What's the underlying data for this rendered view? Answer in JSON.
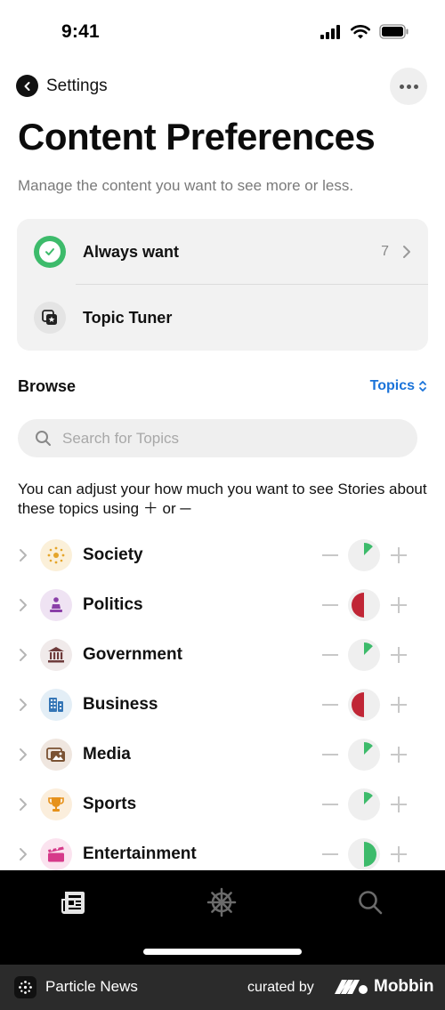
{
  "status_bar": {
    "time": "9:41"
  },
  "nav": {
    "back_label": "Settings"
  },
  "page": {
    "title": "Content Preferences",
    "subtitle": "Manage the content you want to see more or less."
  },
  "card": {
    "always_want": {
      "label": "Always want",
      "count": "7",
      "icon": "checkmark-icon"
    },
    "topic_tuner": {
      "label": "Topic Tuner",
      "icon": "topic-tuner-icon"
    }
  },
  "browse": {
    "label": "Browse",
    "sort_label": "Topics",
    "search_placeholder": "Search for Topics",
    "info_text": "You can adjust your how much you want to see Stories about these topics using ＋ or ─"
  },
  "topics": [
    {
      "label": "Society",
      "icon": "sparkles-icon",
      "icon_bg": "#fbf0d9",
      "icon_color": "#e5a52a",
      "level": 0.125,
      "level_color": "#3dbb6b"
    },
    {
      "label": "Politics",
      "icon": "podium-icon",
      "icon_bg": "#efe3f3",
      "icon_color": "#8a3fa8",
      "level": 0.5,
      "level_color": "#c02636",
      "level_side": "left"
    },
    {
      "label": "Government",
      "icon": "building-columns-icon",
      "icon_bg": "#f0eaea",
      "icon_color": "#6e3b3b",
      "level": 0.125,
      "level_color": "#3dbb6b"
    },
    {
      "label": "Business",
      "icon": "office-building-icon",
      "icon_bg": "#e3eef6",
      "icon_color": "#3576b6",
      "level": 0.5,
      "level_color": "#c02636",
      "level_side": "left"
    },
    {
      "label": "Media",
      "icon": "photos-icon",
      "icon_bg": "#efe6df",
      "icon_color": "#7a5233",
      "level": 0.125,
      "level_color": "#3dbb6b"
    },
    {
      "label": "Sports",
      "icon": "trophy-icon",
      "icon_bg": "#fbeedc",
      "icon_color": "#e6911a",
      "level": 0.125,
      "level_color": "#3dbb6b"
    },
    {
      "label": "Entertainment",
      "icon": "clapperboard-icon",
      "icon_bg": "#fbe3ef",
      "icon_color": "#d63a8a",
      "level": 0.5,
      "level_color": "#3dbb6b",
      "level_side": "right"
    }
  ],
  "tabbar": {
    "tabs": [
      {
        "icon": "newspaper-icon",
        "active": true
      },
      {
        "icon": "ship-wheel-icon",
        "active": false
      },
      {
        "icon": "search-icon",
        "active": false
      }
    ]
  },
  "footer": {
    "app_name": "Particle News",
    "curated_by": "curated by",
    "brand": "Mobbin"
  },
  "colors": {
    "accent_blue": "#1a73d9",
    "green": "#3dbb6b",
    "red": "#c02636"
  }
}
